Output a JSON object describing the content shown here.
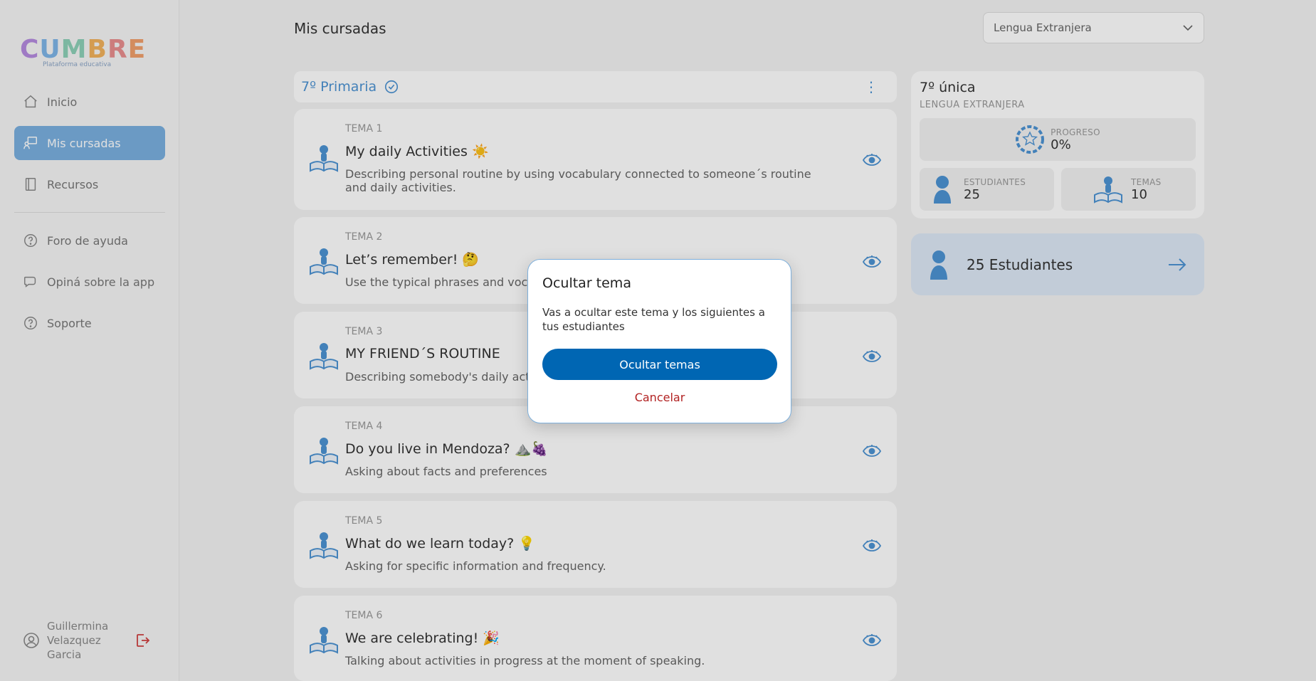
{
  "brand": {
    "logo": "CUMBRE",
    "subtitle": "Plataforma educativa"
  },
  "sidebar": {
    "items": [
      {
        "label": "Inicio",
        "icon": "home-icon"
      },
      {
        "label": "Mis cursadas",
        "icon": "classroom-icon",
        "active": true
      },
      {
        "label": "Recursos",
        "icon": "book-icon"
      },
      {
        "label": "Foro de ayuda",
        "icon": "help-circle-icon"
      },
      {
        "label": "Opiná sobre la app",
        "icon": "chat-icon"
      },
      {
        "label": "Soporte",
        "icon": "help-circle-icon"
      }
    ],
    "user": {
      "name": "Guillermina Velazquez Garcia"
    }
  },
  "header": {
    "title": "Mis cursadas",
    "subject_select": "Lengua Extranjera"
  },
  "course": {
    "name": "7º Primaria"
  },
  "topics": [
    {
      "num": "TEMA 1",
      "title": "My daily Activities ☀️",
      "desc": "Describing personal routine by using vocabulary connected to someone´s routine and daily activities."
    },
    {
      "num": "TEMA 2",
      "title": "Let’s remember! 🤔",
      "desc": "Use the typical phrases and voca"
    },
    {
      "num": "TEMA 3",
      "title": "MY FRIEND´S ROUTINE",
      "desc": "Describing somebody's daily act"
    },
    {
      "num": "TEMA 4",
      "title": "Do you live in Mendoza? ⛰️🍇",
      "desc": "Asking about facts and preferences"
    },
    {
      "num": "TEMA 5",
      "title": "What do we learn today? 💡",
      "desc": "Asking for specific information and frequency."
    },
    {
      "num": "TEMA 6",
      "title": "We are celebrating! 🎉",
      "desc": "Talking about activities in progress at the moment of speaking."
    }
  ],
  "info": {
    "title": "7º única",
    "subject": "LENGUA EXTRANJERA",
    "progress": {
      "label": "PROGRESO",
      "value": "0%",
      "fraction": 0
    },
    "students": {
      "label": "ESTUDIANTES",
      "value": "25"
    },
    "topics": {
      "label": "TEMAS",
      "value": "10"
    }
  },
  "students_link": {
    "label": "25 Estudiantes"
  },
  "modal": {
    "title": "Ocultar tema",
    "text": "Vas a ocultar este tema y los siguientes a tus estudiantes",
    "confirm": "Ocultar temas",
    "cancel": "Cancelar"
  },
  "colors": {
    "accent": "#4d93d3",
    "primary_button": "#0066b3",
    "danger": "#b22222",
    "active_nav": "#7ab0e0"
  }
}
